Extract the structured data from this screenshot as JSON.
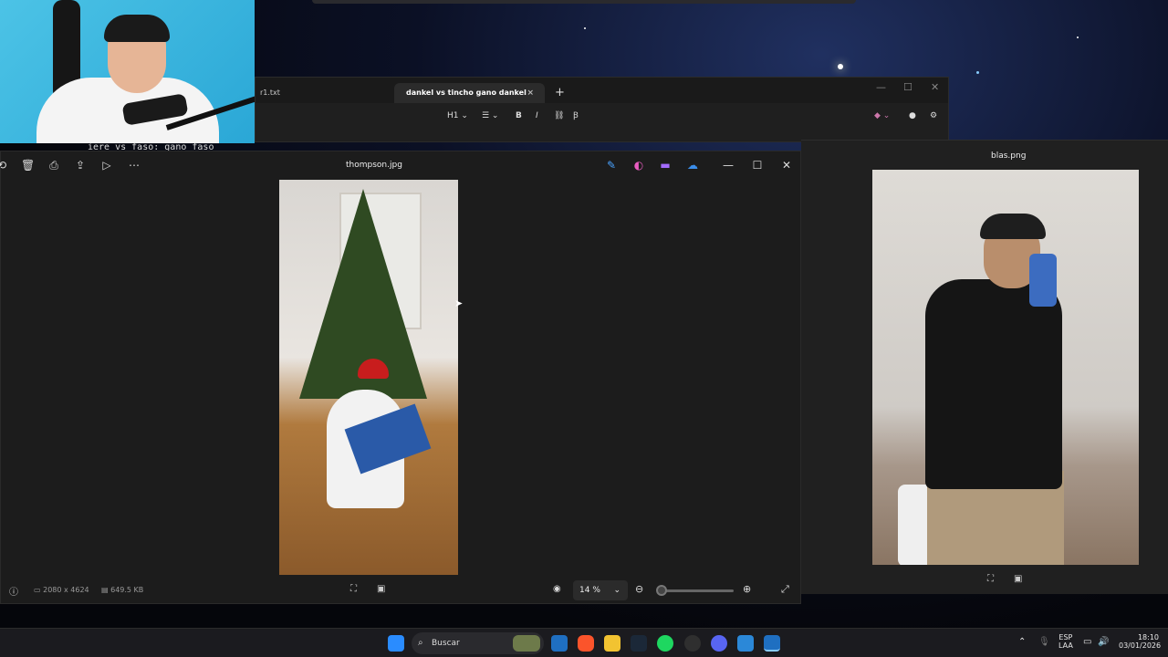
{
  "webcam": {
    "caption": "iere vs faso: gano faso"
  },
  "notepad": {
    "tab1": "r1.txt",
    "tab2": "dankel vs tincho gano dankel",
    "tab_close": "×",
    "new_tab": "+",
    "heading_select": "H1",
    "bold": "B",
    "italic": "I"
  },
  "viewer": {
    "filename": "thompson.jpg",
    "dimensions": "2080 x 4624",
    "filesize": "649.5 KB",
    "zoom": "14 %"
  },
  "viewer2": {
    "filename": "blas.png"
  },
  "taskbar": {
    "search_placeholder": "Buscar",
    "lang_line1": "ESP",
    "lang_line2": "LAA",
    "time": "18:10",
    "date": "03/01/2026"
  },
  "colors": {
    "accent": "#0a84ff",
    "spotify": "#1ed760",
    "brave": "#fb542b"
  }
}
